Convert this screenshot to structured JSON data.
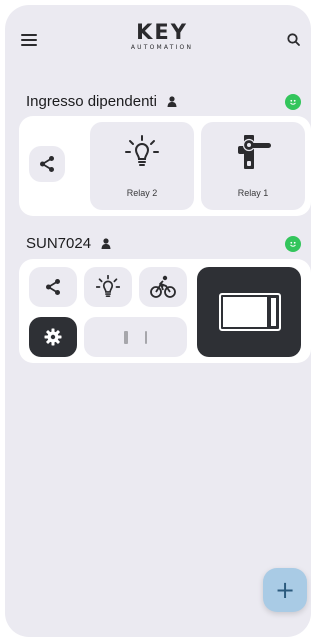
{
  "header": {
    "logo_main": "KEY",
    "logo_sub": "AUTOMATION",
    "menu_icon": "hamburger-menu-icon",
    "search_icon": "search-icon"
  },
  "groups": [
    {
      "title": "Ingresso dipendenti",
      "status_color": "#33c55c",
      "tiles": [
        {
          "icon": "share-icon",
          "label": ""
        },
        {
          "icon": "light-bulb-icon",
          "label": "Relay 2"
        },
        {
          "icon": "door-handle-icon",
          "label": "Relay 1"
        }
      ]
    },
    {
      "title": "SUN7024",
      "status_color": "#33c55c",
      "tiles": [
        {
          "icon": "share-icon",
          "label": ""
        },
        {
          "icon": "light-bulb-icon",
          "label": ""
        },
        {
          "icon": "cyclist-icon",
          "label": ""
        },
        {
          "icon": "gear-icon",
          "label": ""
        },
        {
          "icon": "gate-position-icon",
          "label": ""
        },
        {
          "icon": "sliding-gate-icon",
          "label": ""
        }
      ]
    }
  ],
  "fab": {
    "label": "+"
  },
  "colors": {
    "background": "#ebeaf1",
    "card": "#ffffff",
    "tile": "#ebeaf1",
    "dark_tile": "#2e3035",
    "status_online": "#33c55c",
    "fab": "#a9cbe5"
  }
}
